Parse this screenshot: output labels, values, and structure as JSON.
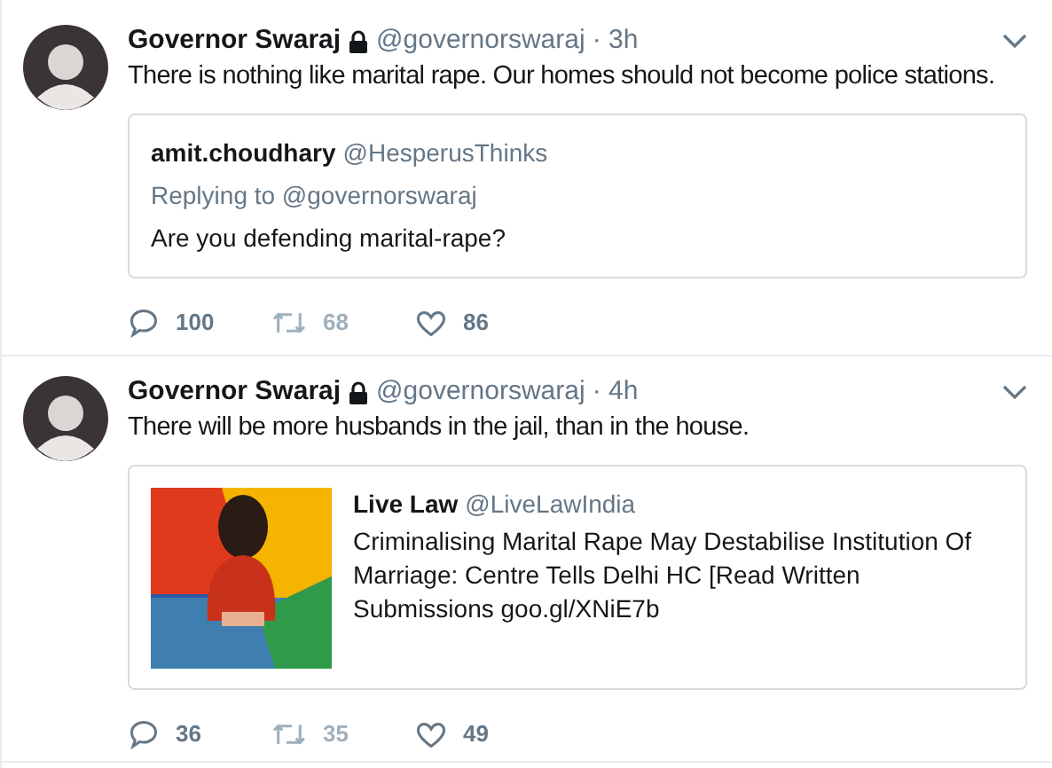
{
  "tweets": [
    {
      "name": "Governor Swaraj",
      "protected": true,
      "handle": "@governorswaraj",
      "time": "· 3h",
      "text": "There is nothing like marital rape. Our homes should not become police stations.",
      "quote": {
        "kind": "quote",
        "name": "amit.choudhary",
        "handle": "@HesperusThinks",
        "replying": "Replying to @governorswaraj",
        "text": "Are you defending marital-rape?"
      },
      "actions": [
        {
          "kind": "reply",
          "count": "100",
          "disabled": false
        },
        {
          "kind": "retweet",
          "count": "68",
          "disabled": true
        },
        {
          "kind": "like",
          "count": "86",
          "disabled": false
        }
      ]
    },
    {
      "name": "Governor Swaraj",
      "protected": true,
      "handle": "@governorswaraj",
      "time": "· 4h",
      "text": "There will be more husbands in the jail, than in the house.",
      "quote": {
        "kind": "link",
        "name": "Live Law",
        "handle": "@LiveLawIndia",
        "text": "Criminalising Marital Rape May Destabilise Institution Of Marriage: Centre Tells Delhi HC [Read Written Submissions goo.gl/XNiE7b"
      },
      "actions": [
        {
          "kind": "reply",
          "count": "36",
          "disabled": false
        },
        {
          "kind": "retweet",
          "count": "35",
          "disabled": true
        },
        {
          "kind": "like",
          "count": "49",
          "disabled": false
        }
      ]
    }
  ]
}
